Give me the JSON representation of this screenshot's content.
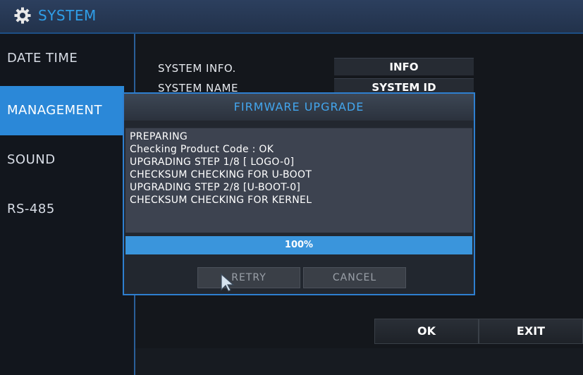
{
  "window": {
    "title": "SYSTEM",
    "icon": "gear-icon",
    "accent_color": "#2f9ee8"
  },
  "sidebar": {
    "items": [
      {
        "label": "DATE TIME",
        "active": false
      },
      {
        "label": "MANAGEMENT",
        "active": true
      },
      {
        "label": "SOUND",
        "active": false
      },
      {
        "label": "RS-485",
        "active": false
      }
    ],
    "active_color": "#2b88d8"
  },
  "main": {
    "rows": [
      {
        "label": "SYSTEM INFO.",
        "value": "INFO"
      },
      {
        "label": "SYSTEM NAME",
        "value": "SYSTEM ID"
      }
    ],
    "buttons": {
      "ok": "OK",
      "exit": "EXIT"
    }
  },
  "dialog": {
    "title": "FIRMWARE UPGRADE",
    "log": [
      "PREPARING",
      "Checking Product Code : OK",
      "UPGRADING STEP 1/8 [  LOGO-0]",
      "CHECKSUM CHECKING FOR U-BOOT",
      "UPGRADING STEP 2/8 [U-BOOT-0]",
      "CHECKSUM CHECKING FOR KERNEL"
    ],
    "progress": {
      "value": 1.0,
      "label": "100%",
      "color": "#3a95dc"
    },
    "buttons": {
      "retry": "RETRY",
      "cancel": "CANCEL"
    }
  }
}
